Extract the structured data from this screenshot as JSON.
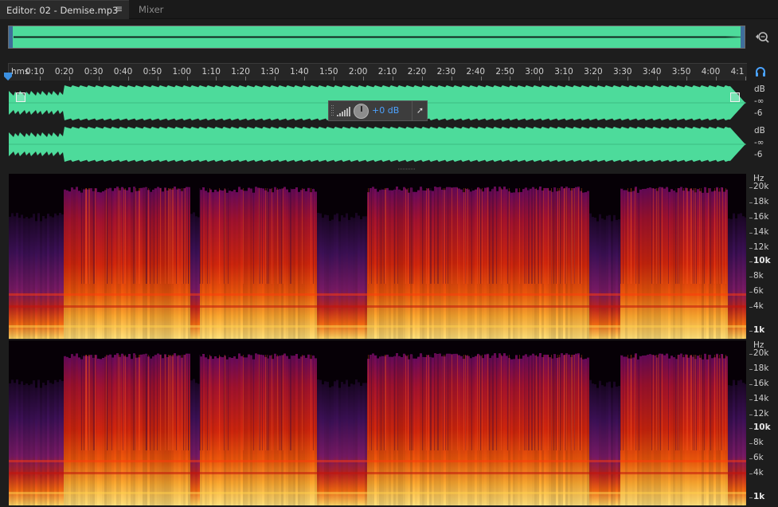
{
  "tabs": {
    "editor_label": "Editor: 02 - Demise.mp3",
    "menu_icon": "hamburger-icon",
    "mixer_label": "Mixer"
  },
  "overview": {
    "color": "#4ddb9b",
    "zoom_icon": "zoom-selection-icon"
  },
  "ruler": {
    "unit": "hms",
    "ticks": [
      "0:10",
      "0:20",
      "0:30",
      "0:40",
      "0:50",
      "1:00",
      "1:10",
      "1:20",
      "1:30",
      "1:40",
      "1:50",
      "2:00",
      "2:10",
      "2:20",
      "2:30",
      "2:40",
      "2:50",
      "3:00",
      "3:10",
      "3:20",
      "3:30",
      "3:40",
      "3:50",
      "4:00",
      "4:1"
    ],
    "headphone_icon": "headphones-icon"
  },
  "waveform": {
    "color": "#4ddb9b",
    "channels": [
      {
        "db_unit": "dB",
        "db_inf": "-∞",
        "db_6": "-6"
      },
      {
        "db_unit": "dB",
        "db_inf": "-∞",
        "db_6": "-6"
      }
    ]
  },
  "hud": {
    "value": "+0 dB",
    "pin_icon": "pin-icon",
    "knob_icon": "volume-knob-icon"
  },
  "spectrogram": {
    "hz_unit": "Hz",
    "labels": [
      "20k",
      "18k",
      "16k",
      "14k",
      "12k",
      "10k",
      "8k",
      "6k",
      "4k",
      "1k"
    ],
    "bold_labels": [
      "10k",
      "1k"
    ]
  }
}
